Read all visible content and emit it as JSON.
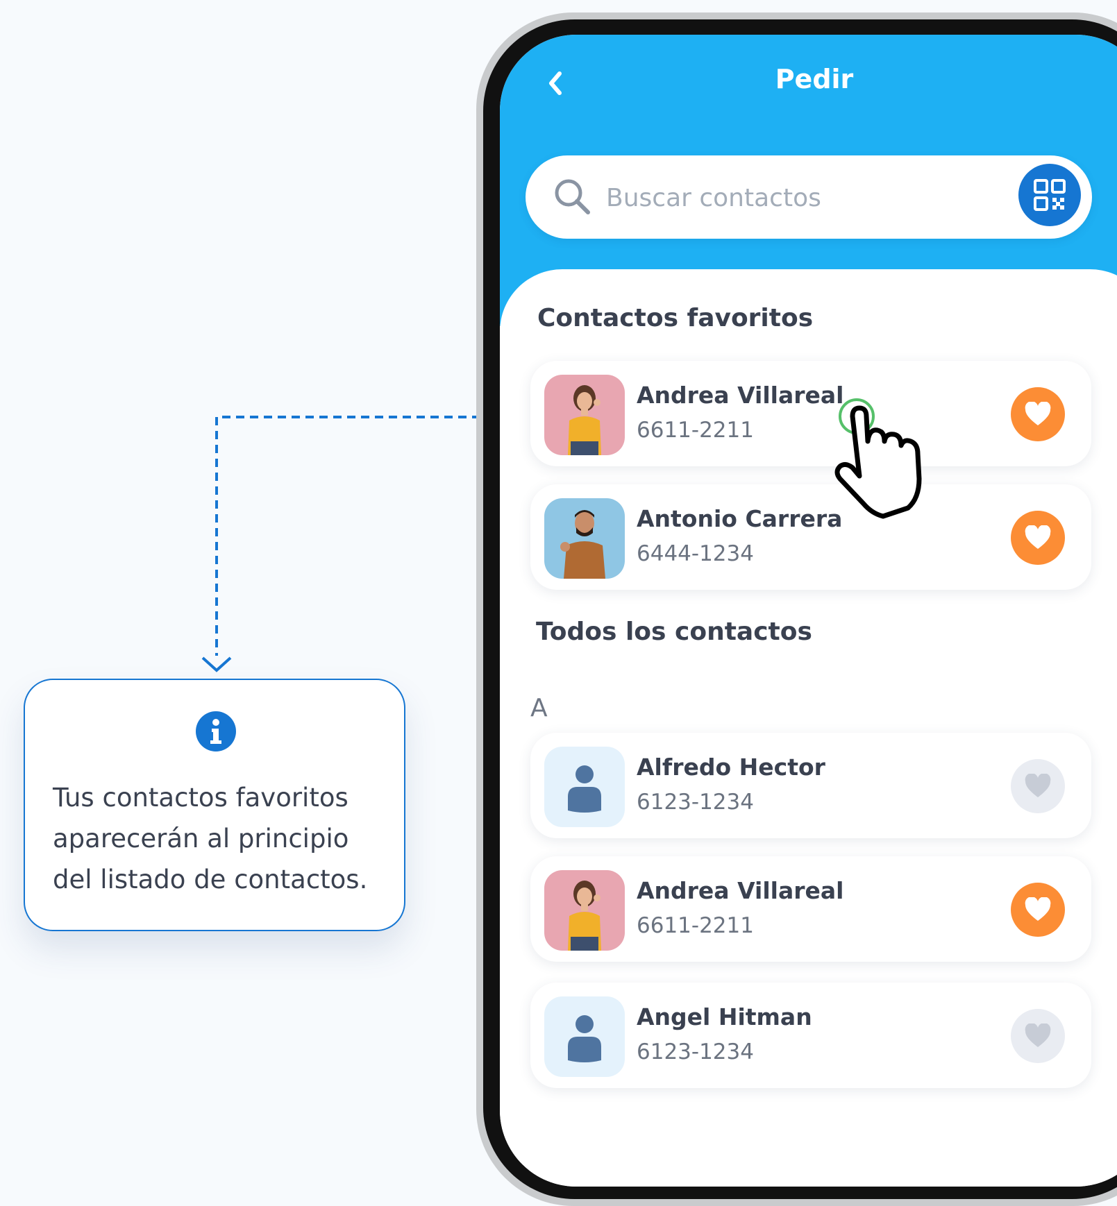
{
  "header": {
    "title": "Pedir",
    "back_icon": "chevron-left-icon"
  },
  "search": {
    "placeholder": "Buscar contactos",
    "value": "",
    "qr_icon": "qr-code-icon"
  },
  "favorites": {
    "title": "Contactos favoritos",
    "contacts": [
      {
        "name": "Andrea Villareal",
        "phone": "6611-2211",
        "avatar": "photo-woman-yellow-shirt",
        "favorite": true
      },
      {
        "name": "Antonio Carrera",
        "phone": "6444-1234",
        "avatar": "photo-man-brown-sweater",
        "favorite": true
      }
    ]
  },
  "all_contacts": {
    "title": "Todos los contactos",
    "groups": [
      {
        "letter": "A",
        "contacts": [
          {
            "name": "Alfredo Hector",
            "phone": "6123-1234",
            "avatar": "person-placeholder-icon",
            "favorite": false
          },
          {
            "name": "Andrea Villareal",
            "phone": "6611-2211",
            "avatar": "photo-woman-yellow-shirt",
            "favorite": true
          },
          {
            "name": "Angel Hitman",
            "phone": "6123-1234",
            "avatar": "person-placeholder-icon",
            "favorite": false
          }
        ]
      }
    ]
  },
  "tooltip": {
    "icon": "info-icon",
    "text": "Tus contactos favoritos aparecerán al principio del listado de contactos."
  },
  "colors": {
    "header_blue": "#1eb0f3",
    "accent_blue": "#1676d2",
    "favorite_orange": "#fc8d35",
    "heart_off": "#e9ecf2",
    "text_dark": "#3a4150"
  }
}
